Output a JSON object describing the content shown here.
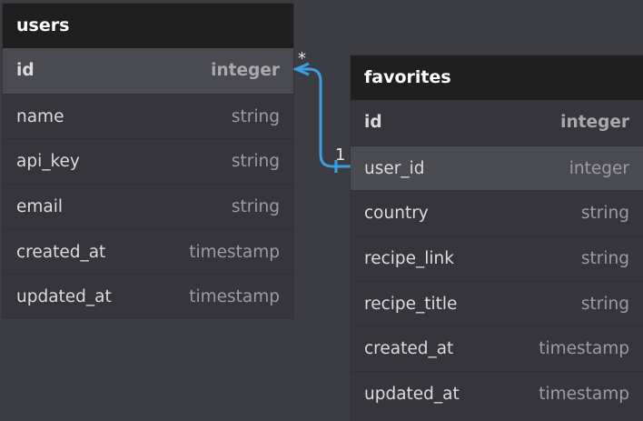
{
  "tables": {
    "users": {
      "title": "users",
      "columns": [
        {
          "name": "id",
          "type": "integer"
        },
        {
          "name": "name",
          "type": "string"
        },
        {
          "name": "api_key",
          "type": "string"
        },
        {
          "name": "email",
          "type": "string"
        },
        {
          "name": "created_at",
          "type": "timestamp"
        },
        {
          "name": "updated_at",
          "type": "timestamp"
        }
      ]
    },
    "favorites": {
      "title": "favorites",
      "columns": [
        {
          "name": "id",
          "type": "integer"
        },
        {
          "name": "user_id",
          "type": "integer"
        },
        {
          "name": "country",
          "type": "string"
        },
        {
          "name": "recipe_link",
          "type": "string"
        },
        {
          "name": "recipe_title",
          "type": "string"
        },
        {
          "name": "created_at",
          "type": "timestamp"
        },
        {
          "name": "updated_at",
          "type": "timestamp"
        }
      ]
    }
  },
  "relationship": {
    "many_label": "*",
    "one_label": "1",
    "color": "#3aa0e0"
  }
}
